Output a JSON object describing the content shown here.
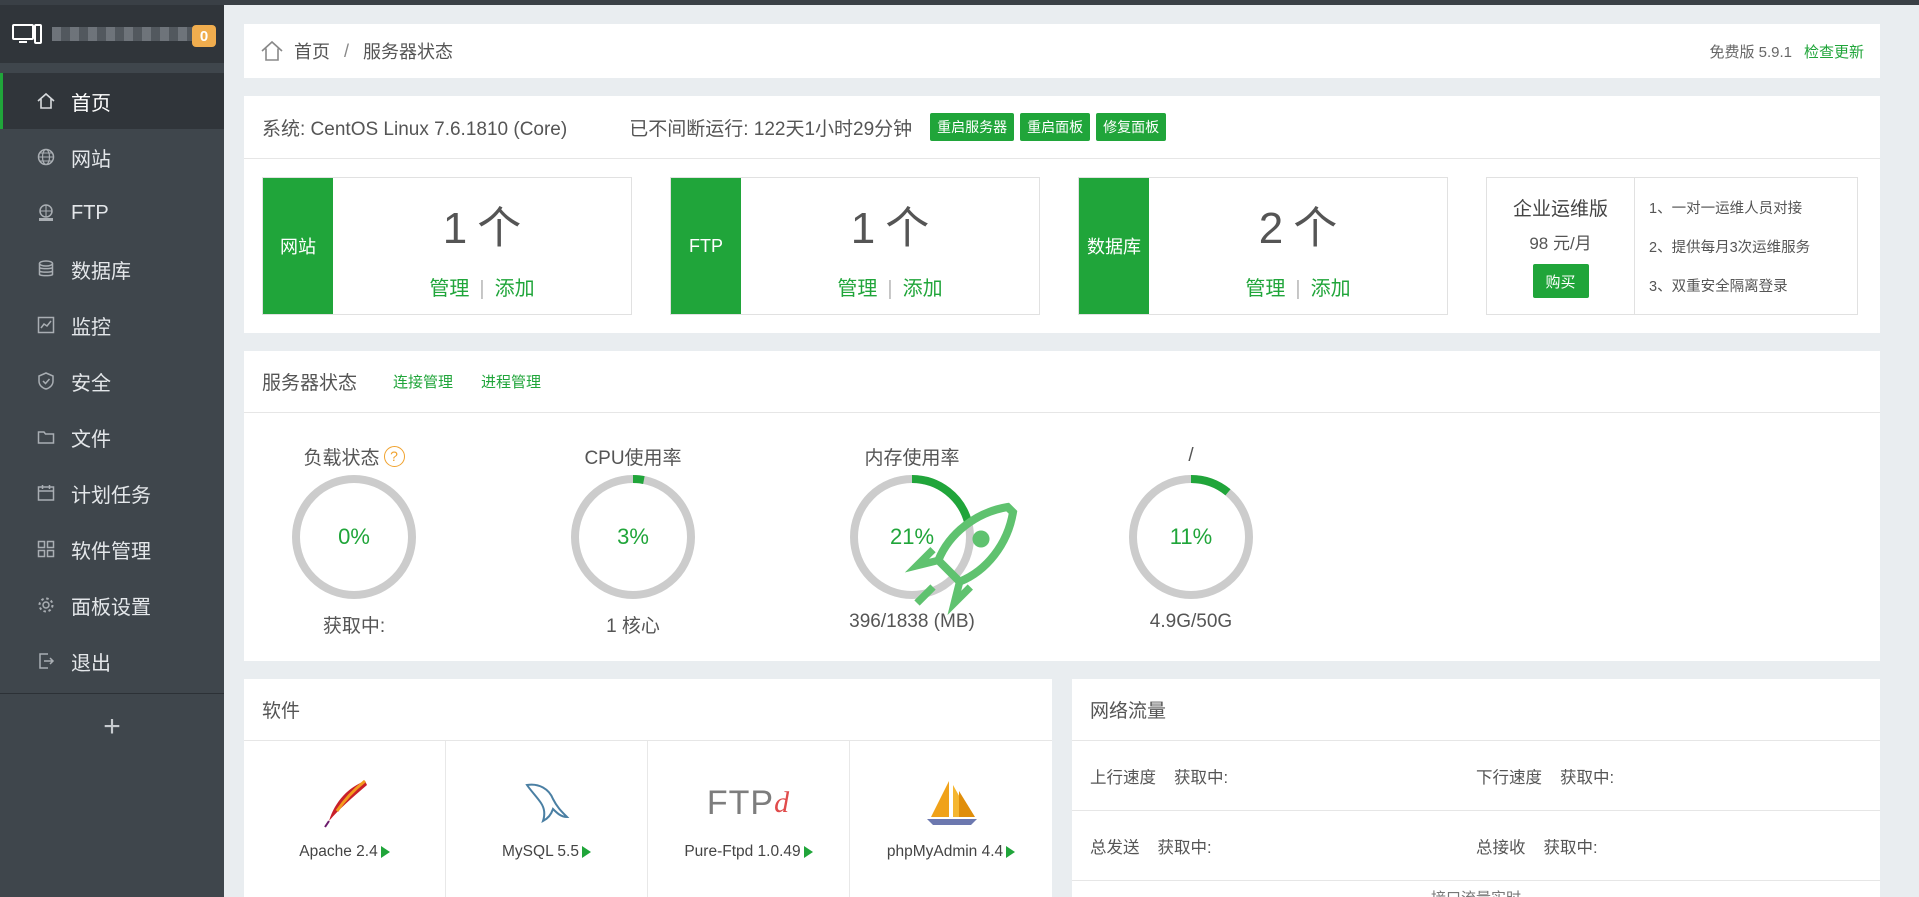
{
  "sidebar": {
    "badge": "0",
    "items": [
      {
        "label": "首页",
        "icon": "home-icon"
      },
      {
        "label": "网站",
        "icon": "globe-icon"
      },
      {
        "label": "FTP",
        "icon": "ftp-icon"
      },
      {
        "label": "数据库",
        "icon": "database-icon"
      },
      {
        "label": "监控",
        "icon": "monitor-chart-icon"
      },
      {
        "label": "安全",
        "icon": "shield-icon"
      },
      {
        "label": "文件",
        "icon": "folder-icon"
      },
      {
        "label": "计划任务",
        "icon": "calendar-icon"
      },
      {
        "label": "软件管理",
        "icon": "grid-icon"
      },
      {
        "label": "面板设置",
        "icon": "gear-icon"
      },
      {
        "label": "退出",
        "icon": "logout-icon"
      }
    ],
    "add_label": "+"
  },
  "breadcrumb": {
    "home": "首页",
    "sep": "/",
    "current": "服务器状态",
    "version": "免费版 5.9.1",
    "update": "检查更新"
  },
  "system": {
    "os": "系统: CentOS Linux 7.6.1810 (Core)",
    "uptime": "已不间断运行: 122天1小时29分钟",
    "btn_restart_server": "重启服务器",
    "btn_restart_panel": "重启面板",
    "btn_repair_panel": "修复面板"
  },
  "cards": [
    {
      "label": "网站",
      "count": "1",
      "unit": "个",
      "manage": "管理",
      "pipe": "|",
      "add": "添加"
    },
    {
      "label": "FTP",
      "count": "1",
      "unit": "个",
      "manage": "管理",
      "pipe": "|",
      "add": "添加"
    },
    {
      "label": "数据库",
      "count": "2",
      "unit": "个",
      "manage": "管理",
      "pipe": "|",
      "add": "添加"
    }
  ],
  "enterprise": {
    "title": "企业运维版",
    "price": "98 元/月",
    "buy": "购买",
    "features": [
      "1、一对一运维人员对接",
      "2、提供每月3次运维服务",
      "3、双重安全隔离登录"
    ]
  },
  "status": {
    "title": "服务器状态",
    "link_conn": "连接管理",
    "link_proc": "进程管理",
    "gauges": [
      {
        "title": "负载状态",
        "value_text": "0%",
        "value": 0,
        "foot": "获取中:",
        "help": "?"
      },
      {
        "title": "CPU使用率",
        "value_text": "3%",
        "value": 3,
        "foot": "1 核心"
      },
      {
        "title": "内存使用率",
        "value_text": "21%",
        "value": 21,
        "foot": "396/1838 (MB)"
      },
      {
        "title": "/",
        "value_text": "11%",
        "value": 11,
        "foot": "4.9G/50G"
      }
    ]
  },
  "software": {
    "title": "软件",
    "items": [
      {
        "name": "Apache 2.4",
        "icon": "apache-feather-icon"
      },
      {
        "name": "MySQL 5.5",
        "icon": "mysql-dolphin-icon"
      },
      {
        "name": "Pure-Ftpd 1.0.49",
        "icon": "ftpd-logo-icon",
        "logo_text": "FTP",
        "logo_suffix": "d"
      },
      {
        "name": "phpMyAdmin 4.4",
        "icon": "phpmyadmin-sail-icon"
      }
    ]
  },
  "network": {
    "title": "网络流量",
    "up_label": "上行速度",
    "up_value": "获取中:",
    "down_label": "下行速度",
    "down_value": "获取中:",
    "sent_label": "总发送",
    "sent_value": "获取中:",
    "recv_label": "总接收",
    "recv_value": "获取中:",
    "footer": "接口流量实时"
  },
  "colors": {
    "accent": "#20a53a",
    "gauge_track": "#cccccc",
    "sidebar": "#3f464c",
    "warning": "#f0ad4e"
  }
}
